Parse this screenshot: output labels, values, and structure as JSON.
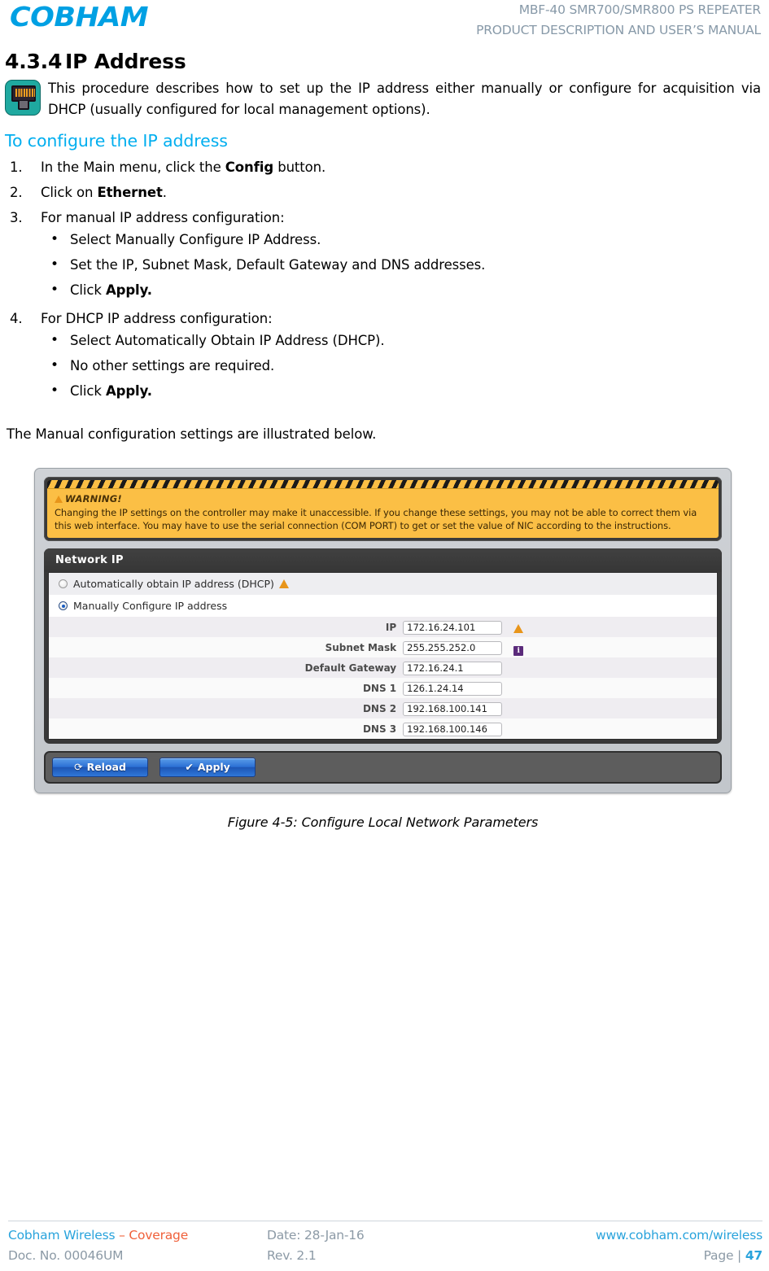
{
  "header": {
    "logo_text": "COBHAM",
    "line1": "MBF-40 SMR700/SMR800 PS REPEATER",
    "line2": "PRODUCT DESCRIPTION AND USER’S MANUAL"
  },
  "section": {
    "number": "4.3.4",
    "title": "IP Address",
    "icon": "rj45-ethernet-icon",
    "intro": "This procedure describes how to set up the IP address either manually or configure for acquisition via DHCP (usually configured for local management options).",
    "subheading": "To configure the IP address"
  },
  "steps": [
    {
      "marker": "1.",
      "pre": "In the Main menu, click the ",
      "bold": "Config",
      "post": " button.",
      "bullets": []
    },
    {
      "marker": "2.",
      "pre": "Click on ",
      "bold": "Ethernet",
      "post": ".",
      "bullets": []
    },
    {
      "marker": "3.",
      "pre": "For manual IP address configuration:",
      "bold": "",
      "post": "",
      "bullets": [
        {
          "pre": "Select Manually Configure IP Address.",
          "bold": "",
          "post": ""
        },
        {
          "pre": "Set the IP, Subnet Mask, Default Gateway and DNS addresses.",
          "bold": "",
          "post": ""
        },
        {
          "pre": "Click ",
          "bold": "Apply.",
          "post": ""
        }
      ]
    },
    {
      "marker": "4.",
      "pre": "For DHCP IP address configuration:",
      "bold": "",
      "post": "",
      "bullets": [
        {
          "pre": "Select Automatically Obtain IP Address (DHCP).",
          "bold": "",
          "post": ""
        },
        {
          "pre": "No other settings are required.",
          "bold": "",
          "post": ""
        },
        {
          "pre": "Click ",
          "bold": "Apply.",
          "post": ""
        }
      ]
    }
  ],
  "after_text": "The Manual configuration settings are illustrated below.",
  "figure": {
    "warning": {
      "icon": "warning-triangle-icon",
      "title": "WARNING!",
      "text": "Changing the IP settings on the controller may make it unaccessible. If you change these settings, you may not be able to correct them via this web interface. You may have to use the serial connection (COM PORT) to get or set the value of NIC according to the instructions."
    },
    "panel_title": "Network IP",
    "radios": [
      {
        "label": "Automatically obtain IP address (DHCP)",
        "selected": false,
        "icon": "warning-triangle-icon"
      },
      {
        "label": "Manually Configure IP address",
        "selected": true,
        "icon": ""
      }
    ],
    "fields": [
      {
        "label": "IP",
        "value": "172.16.24.101",
        "icon": "warning-triangle-icon"
      },
      {
        "label": "Subnet Mask",
        "value": "255.255.252.0",
        "icon": "info-icon"
      },
      {
        "label": "Default Gateway",
        "value": "172.16.24.1",
        "icon": ""
      },
      {
        "label": "DNS 1",
        "value": "126.1.24.14",
        "icon": ""
      },
      {
        "label": "DNS 2",
        "value": "192.168.100.141",
        "icon": ""
      },
      {
        "label": "DNS 3",
        "value": "192.168.100.146",
        "icon": ""
      }
    ],
    "buttons": [
      {
        "label": "Reload",
        "glyph": "⟳",
        "icon": "refresh-icon"
      },
      {
        "label": "Apply",
        "glyph": "✔",
        "icon": "check-icon"
      }
    ],
    "caption": "Figure 4-5:  Configure Local Network Parameters"
  },
  "footer": {
    "company": "Cobham Wireless",
    "company_suffix": " – Coverage",
    "date": "Date: 28-Jan-16",
    "website": "www.cobham.com/wireless",
    "doc_no": "Doc. No. 00046UM",
    "revision": "Rev. 2.1",
    "page_label": "Page |",
    "page_number": "47"
  },
  "colors": {
    "brand_blue": "#00A0E3",
    "sub_heading_blue": "#00AEEF",
    "footer_blue": "#29A3DC",
    "footer_orange": "#F0603A",
    "header_gray": "#8799A8",
    "warning_amber": "#FBBF45",
    "button_blue": "#2a6fd4",
    "icon_teal": "#1FA9A0"
  }
}
